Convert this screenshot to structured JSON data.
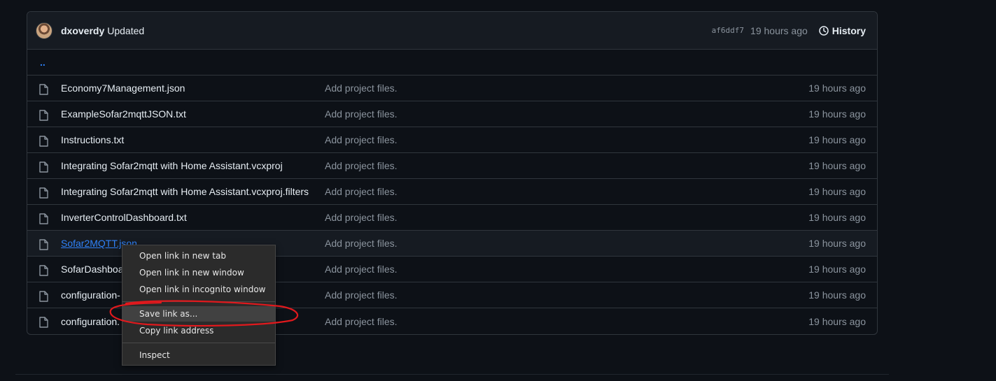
{
  "commit": {
    "author": "dxoverdy",
    "message": "Updated",
    "sha": "af6ddf7",
    "time": "19 hours ago",
    "history_label": "History"
  },
  "parent_dir": "..",
  "files": [
    {
      "name": "Economy7Management.json",
      "message": "Add project files.",
      "time": "19 hours ago"
    },
    {
      "name": "ExampleSofar2mqttJSON.txt",
      "message": "Add project files.",
      "time": "19 hours ago"
    },
    {
      "name": "Instructions.txt",
      "message": "Add project files.",
      "time": "19 hours ago"
    },
    {
      "name": "Integrating Sofar2mqtt with Home Assistant.vcxproj",
      "message": "Add project files.",
      "time": "19 hours ago"
    },
    {
      "name": "Integrating Sofar2mqtt with Home Assistant.vcxproj.filters",
      "message": "Add project files.",
      "time": "19 hours ago"
    },
    {
      "name": "InverterControlDashboard.txt",
      "message": "Add project files.",
      "time": "19 hours ago"
    },
    {
      "name": "Sofar2MQTT.json",
      "message": "Add project files.",
      "time": "19 hours ago"
    },
    {
      "name": "SofarDashboa",
      "message": "Add project files.",
      "time": "19 hours ago"
    },
    {
      "name": "configuration-",
      "message": "Add project files.",
      "time": "19 hours ago"
    },
    {
      "name": "configuration.",
      "message": "Add project files.",
      "time": "19 hours ago"
    }
  ],
  "context_menu": {
    "open_new_tab": "Open link in new tab",
    "open_new_window": "Open link in new window",
    "open_incognito": "Open link in incognito window",
    "save_link_as": "Save link as...",
    "copy_link_address": "Copy link address",
    "inspect": "Inspect"
  },
  "colors": {
    "background": "#0d1117",
    "border": "#30363d",
    "link": "#2f81f7",
    "muted": "#8b949e",
    "annotation": "#e0191d"
  }
}
